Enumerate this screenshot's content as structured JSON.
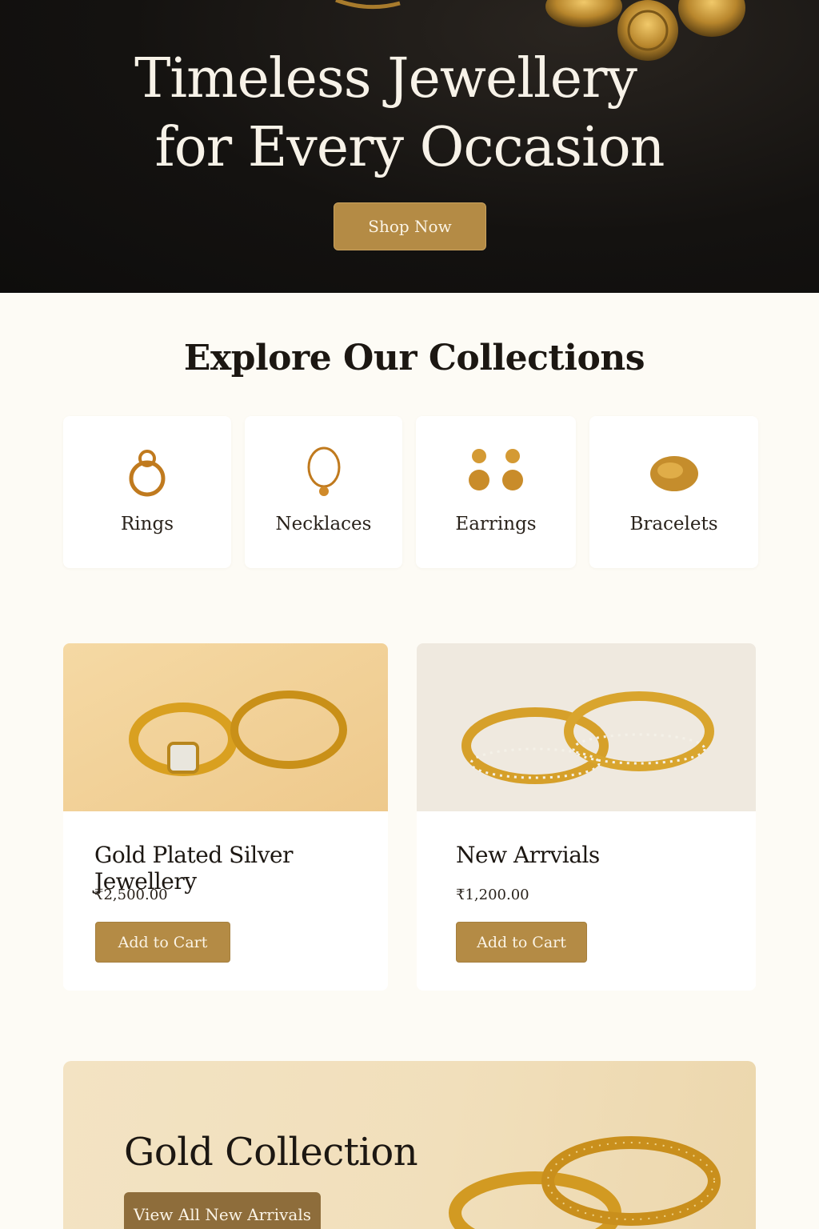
{
  "hero": {
    "title_line1": "Timeless Jewellery",
    "title_line2": "for Every Occasion",
    "cta_label": "Shop Now"
  },
  "collections": {
    "title": "Explore Our Collections",
    "categories": [
      {
        "label": "Rings",
        "icon": "ring-icon"
      },
      {
        "label": "Necklaces",
        "icon": "necklace-icon"
      },
      {
        "label": "Earrings",
        "icon": "earrings-icon"
      },
      {
        "label": "Bracelets",
        "icon": "bracelet-icon"
      }
    ]
  },
  "products": [
    {
      "name": "Gold Plated Silver Jewellery",
      "price": "₹2,500.00",
      "cta": "Add to Cart"
    },
    {
      "name": "New Arrvials",
      "price": "₹1,200.00",
      "cta": "Add to Cart"
    }
  ],
  "banner": {
    "title": "Gold Collection",
    "cta": "View All New Arrivals"
  },
  "colors": {
    "accent": "#b48b45",
    "hero_bg": "#141210",
    "page_bg": "#fdfbf5",
    "gold": "#d9a63a"
  }
}
